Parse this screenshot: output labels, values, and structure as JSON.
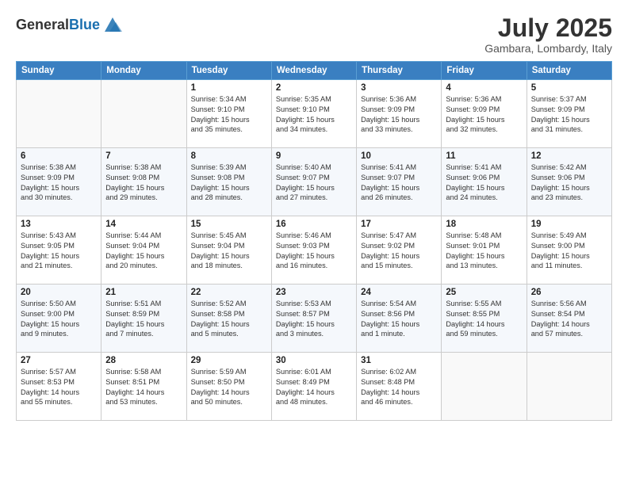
{
  "header": {
    "logo_line1": "General",
    "logo_line2": "Blue",
    "month": "July 2025",
    "location": "Gambara, Lombardy, Italy"
  },
  "weekdays": [
    "Sunday",
    "Monday",
    "Tuesday",
    "Wednesday",
    "Thursday",
    "Friday",
    "Saturday"
  ],
  "weeks": [
    [
      {
        "day": "",
        "detail": ""
      },
      {
        "day": "",
        "detail": ""
      },
      {
        "day": "1",
        "detail": "Sunrise: 5:34 AM\nSunset: 9:10 PM\nDaylight: 15 hours\nand 35 minutes."
      },
      {
        "day": "2",
        "detail": "Sunrise: 5:35 AM\nSunset: 9:10 PM\nDaylight: 15 hours\nand 34 minutes."
      },
      {
        "day": "3",
        "detail": "Sunrise: 5:36 AM\nSunset: 9:09 PM\nDaylight: 15 hours\nand 33 minutes."
      },
      {
        "day": "4",
        "detail": "Sunrise: 5:36 AM\nSunset: 9:09 PM\nDaylight: 15 hours\nand 32 minutes."
      },
      {
        "day": "5",
        "detail": "Sunrise: 5:37 AM\nSunset: 9:09 PM\nDaylight: 15 hours\nand 31 minutes."
      }
    ],
    [
      {
        "day": "6",
        "detail": "Sunrise: 5:38 AM\nSunset: 9:09 PM\nDaylight: 15 hours\nand 30 minutes."
      },
      {
        "day": "7",
        "detail": "Sunrise: 5:38 AM\nSunset: 9:08 PM\nDaylight: 15 hours\nand 29 minutes."
      },
      {
        "day": "8",
        "detail": "Sunrise: 5:39 AM\nSunset: 9:08 PM\nDaylight: 15 hours\nand 28 minutes."
      },
      {
        "day": "9",
        "detail": "Sunrise: 5:40 AM\nSunset: 9:07 PM\nDaylight: 15 hours\nand 27 minutes."
      },
      {
        "day": "10",
        "detail": "Sunrise: 5:41 AM\nSunset: 9:07 PM\nDaylight: 15 hours\nand 26 minutes."
      },
      {
        "day": "11",
        "detail": "Sunrise: 5:41 AM\nSunset: 9:06 PM\nDaylight: 15 hours\nand 24 minutes."
      },
      {
        "day": "12",
        "detail": "Sunrise: 5:42 AM\nSunset: 9:06 PM\nDaylight: 15 hours\nand 23 minutes."
      }
    ],
    [
      {
        "day": "13",
        "detail": "Sunrise: 5:43 AM\nSunset: 9:05 PM\nDaylight: 15 hours\nand 21 minutes."
      },
      {
        "day": "14",
        "detail": "Sunrise: 5:44 AM\nSunset: 9:04 PM\nDaylight: 15 hours\nand 20 minutes."
      },
      {
        "day": "15",
        "detail": "Sunrise: 5:45 AM\nSunset: 9:04 PM\nDaylight: 15 hours\nand 18 minutes."
      },
      {
        "day": "16",
        "detail": "Sunrise: 5:46 AM\nSunset: 9:03 PM\nDaylight: 15 hours\nand 16 minutes."
      },
      {
        "day": "17",
        "detail": "Sunrise: 5:47 AM\nSunset: 9:02 PM\nDaylight: 15 hours\nand 15 minutes."
      },
      {
        "day": "18",
        "detail": "Sunrise: 5:48 AM\nSunset: 9:01 PM\nDaylight: 15 hours\nand 13 minutes."
      },
      {
        "day": "19",
        "detail": "Sunrise: 5:49 AM\nSunset: 9:00 PM\nDaylight: 15 hours\nand 11 minutes."
      }
    ],
    [
      {
        "day": "20",
        "detail": "Sunrise: 5:50 AM\nSunset: 9:00 PM\nDaylight: 15 hours\nand 9 minutes."
      },
      {
        "day": "21",
        "detail": "Sunrise: 5:51 AM\nSunset: 8:59 PM\nDaylight: 15 hours\nand 7 minutes."
      },
      {
        "day": "22",
        "detail": "Sunrise: 5:52 AM\nSunset: 8:58 PM\nDaylight: 15 hours\nand 5 minutes."
      },
      {
        "day": "23",
        "detail": "Sunrise: 5:53 AM\nSunset: 8:57 PM\nDaylight: 15 hours\nand 3 minutes."
      },
      {
        "day": "24",
        "detail": "Sunrise: 5:54 AM\nSunset: 8:56 PM\nDaylight: 15 hours\nand 1 minute."
      },
      {
        "day": "25",
        "detail": "Sunrise: 5:55 AM\nSunset: 8:55 PM\nDaylight: 14 hours\nand 59 minutes."
      },
      {
        "day": "26",
        "detail": "Sunrise: 5:56 AM\nSunset: 8:54 PM\nDaylight: 14 hours\nand 57 minutes."
      }
    ],
    [
      {
        "day": "27",
        "detail": "Sunrise: 5:57 AM\nSunset: 8:53 PM\nDaylight: 14 hours\nand 55 minutes."
      },
      {
        "day": "28",
        "detail": "Sunrise: 5:58 AM\nSunset: 8:51 PM\nDaylight: 14 hours\nand 53 minutes."
      },
      {
        "day": "29",
        "detail": "Sunrise: 5:59 AM\nSunset: 8:50 PM\nDaylight: 14 hours\nand 50 minutes."
      },
      {
        "day": "30",
        "detail": "Sunrise: 6:01 AM\nSunset: 8:49 PM\nDaylight: 14 hours\nand 48 minutes."
      },
      {
        "day": "31",
        "detail": "Sunrise: 6:02 AM\nSunset: 8:48 PM\nDaylight: 14 hours\nand 46 minutes."
      },
      {
        "day": "",
        "detail": ""
      },
      {
        "day": "",
        "detail": ""
      }
    ]
  ]
}
